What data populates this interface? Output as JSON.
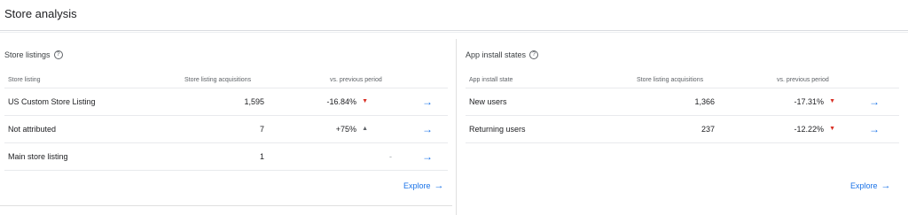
{
  "page": {
    "title": "Store analysis"
  },
  "store_listings": {
    "title": "Store listings",
    "columns": [
      "Store listing",
      "Store listing acquisitions",
      "vs. previous period"
    ],
    "rows": [
      {
        "name": "US Custom Store Listing",
        "acquisitions": "1,595",
        "change": "-16.84%",
        "trend": "down"
      },
      {
        "name": "Not attributed",
        "acquisitions": "7",
        "change": "+75%",
        "trend": "up"
      },
      {
        "name": "Main store listing",
        "acquisitions": "1",
        "change": "-",
        "trend": "none"
      }
    ],
    "explore_label": "Explore"
  },
  "app_install_states": {
    "title": "App install states",
    "columns": [
      "App install state",
      "Store listing acquisitions",
      "vs. previous period"
    ],
    "rows": [
      {
        "name": "New users",
        "acquisitions": "1,366",
        "change": "-17.31%",
        "trend": "down"
      },
      {
        "name": "Returning users",
        "acquisitions": "237",
        "change": "-12.22%",
        "trend": "down"
      }
    ],
    "explore_label": "Explore"
  },
  "icons": {
    "help": "help-circle-icon",
    "trend_down": "triangle-down-icon",
    "trend_up": "triangle-up-icon",
    "row_link": "arrow-right-icon"
  },
  "colors": {
    "accent": "#1a73e8",
    "negative": "#d93025",
    "text": "#202124",
    "muted": "#5f6368"
  }
}
